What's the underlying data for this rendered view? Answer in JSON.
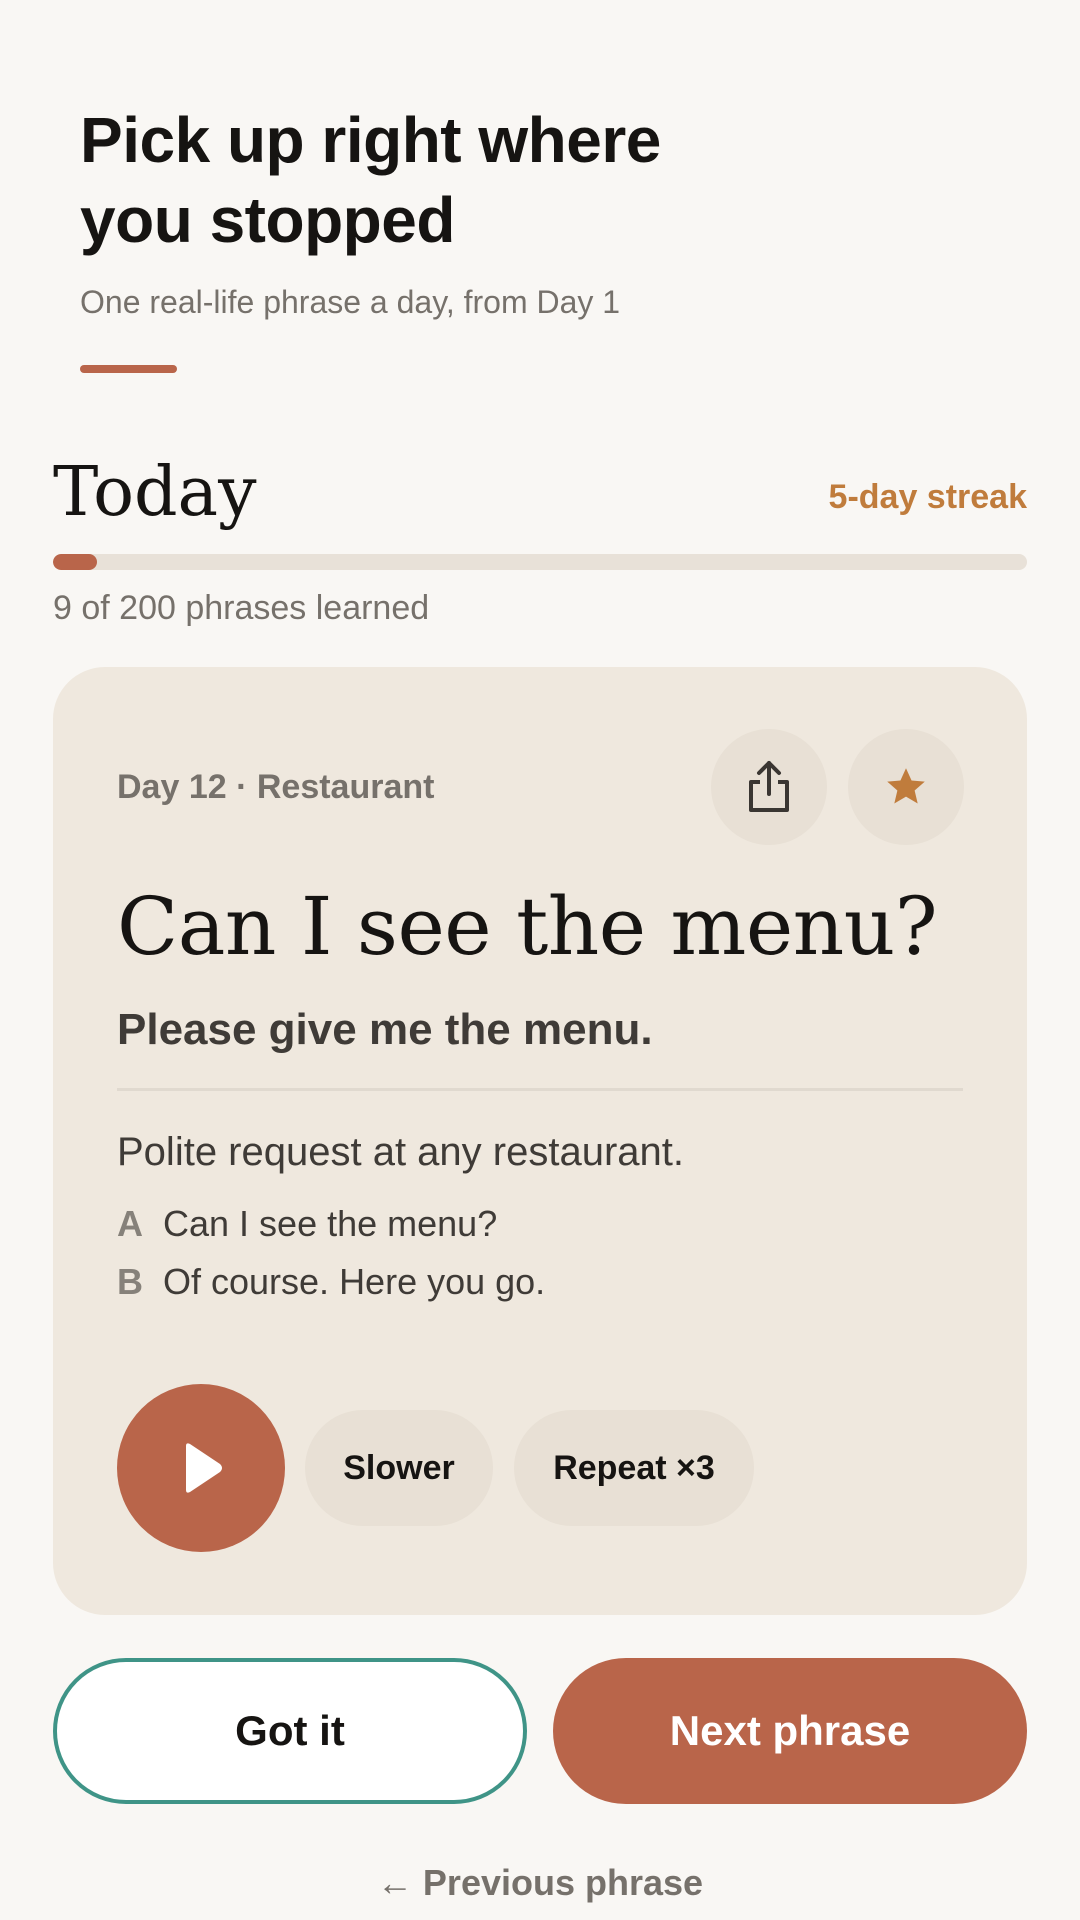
{
  "header": {
    "title_line1": "Pick up right where",
    "title_line2": "you stopped",
    "subtitle": "One real-life phrase a day, from Day 1"
  },
  "today": {
    "title": "Today",
    "streak": "5-day streak",
    "progress_text": "9 of 200 phrases learned",
    "progress_fraction": 0.045
  },
  "card": {
    "meta": "Day 12 · Restaurant",
    "phrase": "Can I see the menu?",
    "translation": "Please give me the menu.",
    "usage": "Polite request at any restaurant.",
    "dialogue": [
      {
        "speaker": "A",
        "text": "Can I see the menu?"
      },
      {
        "speaker": "B",
        "text": "Of course. Here you go."
      }
    ],
    "icons": {
      "share": "share-icon",
      "favorite": "star-icon",
      "play": "play-icon"
    },
    "slower_label": "Slower",
    "repeat_label": "Repeat ×3"
  },
  "actions": {
    "got_it_label": "Got it",
    "next_label": "Next phrase",
    "previous_label": "← Previous phrase"
  },
  "colors": {
    "accent": "#b9654a",
    "streak": "#c07c3c",
    "outline_teal": "#3f9487",
    "background": "#f9f7f4",
    "card": "#efe8de"
  }
}
